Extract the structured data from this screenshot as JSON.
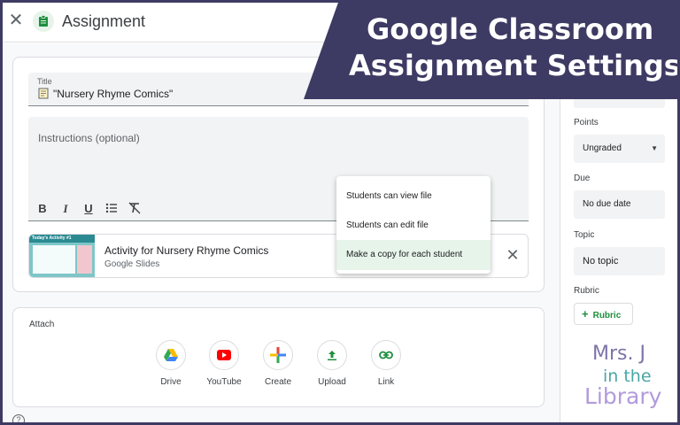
{
  "header": {
    "close_icon": "close-icon",
    "title": "Assignment"
  },
  "banner": {
    "line1": "Google Classroom",
    "line2": "Assignment Settings",
    "color": "#3d3a63"
  },
  "form": {
    "title_label": "Title",
    "title_value": "\"Nursery Rhyme Comics\"",
    "instructions_placeholder": "Instructions (optional)",
    "format_buttons": [
      "B",
      "I",
      "U",
      "list",
      "clear"
    ]
  },
  "attachment": {
    "thumb_title": "Today's Activity #1",
    "name": "Activity for Nursery Rhyme Comics",
    "type": "Google Slides"
  },
  "share_menu": {
    "items": [
      {
        "label": "Students can view file",
        "selected": false
      },
      {
        "label": "Students can edit file",
        "selected": false
      },
      {
        "label": "Make a copy for each student",
        "selected": true
      }
    ]
  },
  "attach_section": {
    "label": "Attach",
    "buttons": [
      {
        "label": "Drive",
        "icon": "drive-icon"
      },
      {
        "label": "YouTube",
        "icon": "youtube-icon"
      },
      {
        "label": "Create",
        "icon": "plus-icon"
      },
      {
        "label": "Upload",
        "icon": "upload-icon"
      },
      {
        "label": "Link",
        "icon": "link-icon"
      }
    ]
  },
  "sidebar": {
    "points_label": "Points",
    "points_value": "Ungraded",
    "due_label": "Due",
    "due_value": "No due date",
    "topic_label": "Topic",
    "topic_value": "No topic",
    "rubric_label": "Rubric",
    "rubric_button": "Rubric"
  },
  "logo": {
    "line1": "Mrs. J",
    "line2": "in the",
    "line3": "Library"
  },
  "colors": {
    "accent_green": "#1e8e3e",
    "selected_bg": "#e6f4ea",
    "frame": "#3d3a63"
  }
}
